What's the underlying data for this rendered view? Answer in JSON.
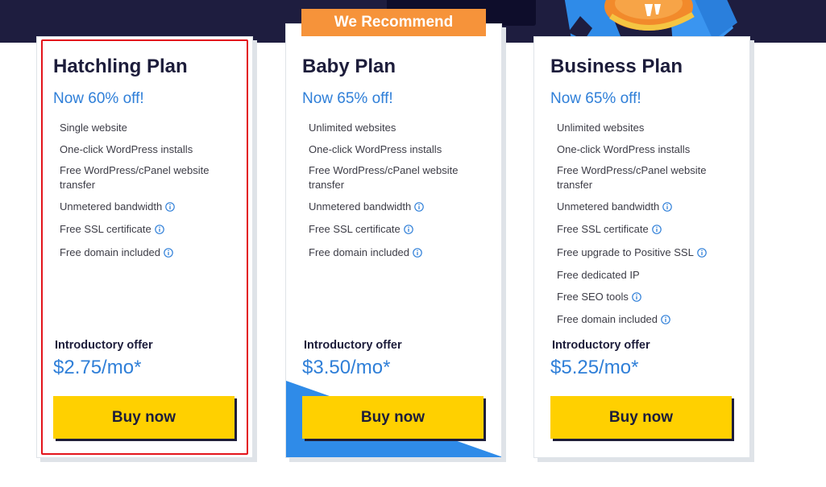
{
  "badge": {
    "text": "We Recommend"
  },
  "plans": [
    {
      "title": "Hatchling Plan",
      "discount": "Now 60% off!",
      "features": [
        {
          "text": "Single website",
          "info": false
        },
        {
          "text": "One-click WordPress installs",
          "info": false
        },
        {
          "text": "Free WordPress/cPanel website transfer",
          "info": false
        },
        {
          "text": "Unmetered bandwidth",
          "info": true
        },
        {
          "text": "Free SSL certificate",
          "info": true
        },
        {
          "text": "Free domain included",
          "info": true
        }
      ],
      "intro_label": "Introductory offer",
      "price": "$2.75/mo*",
      "button_label": "Buy now"
    },
    {
      "title": "Baby Plan",
      "discount": "Now 65% off!",
      "features": [
        {
          "text": "Unlimited websites",
          "info": false
        },
        {
          "text": "One-click WordPress installs",
          "info": false
        },
        {
          "text": "Free WordPress/cPanel website transfer",
          "info": false
        },
        {
          "text": "Unmetered bandwidth",
          "info": true
        },
        {
          "text": "Free SSL certificate",
          "info": true
        },
        {
          "text": "Free domain included",
          "info": true
        }
      ],
      "intro_label": "Introductory offer",
      "price": "$3.50/mo*",
      "button_label": "Buy now"
    },
    {
      "title": "Business Plan",
      "discount": "Now 65% off!",
      "features": [
        {
          "text": "Unlimited websites",
          "info": false
        },
        {
          "text": "One-click WordPress installs",
          "info": false
        },
        {
          "text": "Free WordPress/cPanel website transfer",
          "info": false
        },
        {
          "text": "Unmetered bandwidth",
          "info": true
        },
        {
          "text": "Free SSL certificate",
          "info": true
        },
        {
          "text": "Free upgrade to Positive SSL",
          "info": true
        },
        {
          "text": "Free dedicated IP",
          "info": false
        },
        {
          "text": "Free SEO tools",
          "info": true
        },
        {
          "text": "Free domain included",
          "info": true
        }
      ],
      "intro_label": "Introductory offer",
      "price": "$5.25/mo*",
      "button_label": "Buy now"
    }
  ],
  "colors": {
    "header_band": "#1e1d3f",
    "accent_blue": "#2f7fd8",
    "button_yellow": "#ffd000",
    "badge_orange": "#f6933a",
    "highlight_red": "#e3141b"
  },
  "icons": {
    "feature_info": "info-icon"
  }
}
